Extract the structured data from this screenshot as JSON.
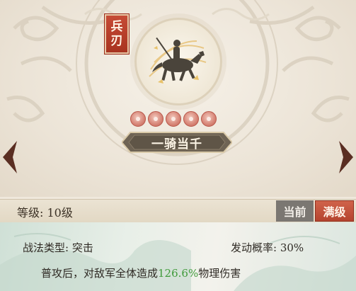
{
  "skill": {
    "weapon_tag": [
      "兵",
      "刃"
    ],
    "name": "一骑当千",
    "stars": 5
  },
  "level": {
    "label": "等级: 10级",
    "current_button": "当前",
    "max_button": "满级"
  },
  "details": {
    "type_label": "战法类型: 突击",
    "chance_label": "发动概率: 30%",
    "desc_prefix": "普攻后，对敌军全体造成",
    "desc_value": "126.6%",
    "desc_suffix": "物理伤害"
  },
  "icons": {
    "left_arrow": "chevron-left-icon",
    "right_arrow": "chevron-right-icon",
    "emblem": "cavalry-emblem-icon"
  },
  "colors": {
    "accent_red": "#b5442f",
    "highlight_green": "#3f9a3a"
  }
}
